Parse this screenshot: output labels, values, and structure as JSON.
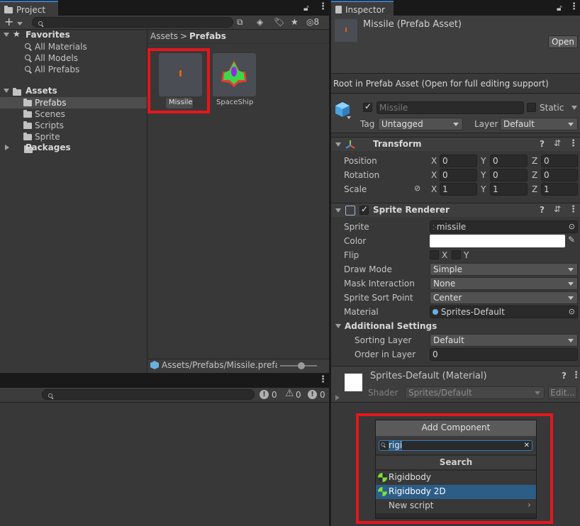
{
  "project_panel": {
    "tab_label": "Project",
    "add_label": "+",
    "search_placeholder": "",
    "hidden_count": "8",
    "favorites": {
      "header": "Favorites",
      "items": [
        "All Materials",
        "All Models",
        "All Prefabs"
      ]
    },
    "assets": {
      "header": "Assets",
      "items": [
        "Prefabs",
        "Scenes",
        "Scripts",
        "Sprite"
      ]
    },
    "packages_label": "Packages",
    "breadcrumb": {
      "root": "Assets",
      "separator": ">",
      "current": "Prefabs"
    },
    "grid_items": [
      {
        "label": "Missile",
        "selected": true
      },
      {
        "label": "SpaceShip",
        "selected": false
      }
    ],
    "status_path": "Assets/Prefabs/Missile.prefab"
  },
  "console_panel": {
    "search_placeholder": "",
    "info_count": "0",
    "warning_count": "0",
    "error_count": "0"
  },
  "inspector": {
    "tab_label": "Inspector",
    "asset_title": "Missile (Prefab Asset)",
    "open_button": "Open",
    "root_notice": "Root in Prefab Asset (Open for full editing support)",
    "gameobject": {
      "name": "Missile",
      "static_label": "Static",
      "tag_label": "Tag",
      "tag_value": "Untagged",
      "layer_label": "Layer",
      "layer_value": "Default"
    },
    "transform": {
      "title": "Transform",
      "rows": [
        {
          "label": "Position",
          "x": "0",
          "y": "0",
          "z": "0"
        },
        {
          "label": "Rotation",
          "x": "0",
          "y": "0",
          "z": "0"
        },
        {
          "label": "Scale",
          "x": "1",
          "y": "1",
          "z": "1"
        }
      ],
      "axis_labels": [
        "X",
        "Y",
        "Z"
      ]
    },
    "sprite_renderer": {
      "title": "Sprite Renderer",
      "sprite_label": "Sprite",
      "sprite_value": "missile",
      "color_label": "Color",
      "color_value": "#ffffff",
      "flip_label": "Flip",
      "flip_x": "X",
      "flip_y": "Y",
      "draw_mode_label": "Draw Mode",
      "draw_mode_value": "Simple",
      "mask_label": "Mask Interaction",
      "mask_value": "None",
      "sort_point_label": "Sprite Sort Point",
      "sort_point_value": "Center",
      "material_label": "Material",
      "material_value": "Sprites-Default",
      "additional_header": "Additional Settings",
      "sorting_layer_label": "Sorting Layer",
      "sorting_layer_value": "Default",
      "order_label": "Order in Layer",
      "order_value": "0"
    },
    "material": {
      "title": "Sprites-Default (Material)",
      "shader_label": "Shader",
      "shader_value": "Sprites/Default",
      "edit_button": "Edit..."
    },
    "add_component": {
      "button_label": "Add Component",
      "search_value": "rigi",
      "section_title": "Search",
      "results": [
        {
          "label": "Rigidbody",
          "selected": false
        },
        {
          "label": "Rigidbody 2D",
          "selected": true
        }
      ],
      "new_script": "New script"
    }
  },
  "colors": {
    "panel_bg": "#383838",
    "tab_accent": "#3a79bb",
    "selection": "#2c5d87",
    "highlight_red": "#e5161d"
  }
}
